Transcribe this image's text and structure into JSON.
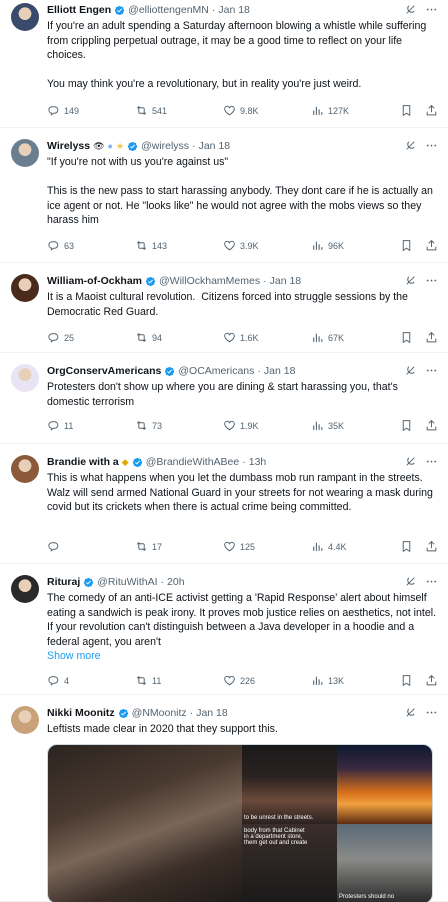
{
  "tweets": [
    {
      "name": "Elliott Engen",
      "badges": [],
      "handle": "@elliottengenMN",
      "time": "Jan 18",
      "text": "If you're an adult spending a Saturday afternoon blowing a whistle while suffering from crippling perpetual outrage, it may be a good time to reflect on your life choices.\n\nYou may think you're a revolutionary, but in reality you're just weird.",
      "replies": "149",
      "reposts": "541",
      "likes": "9.8K",
      "views": "127K",
      "avatar_color": "#3a4a6b"
    },
    {
      "name": "Wirelyss",
      "badges": [
        "eye-emoji",
        "speech-bubble-emoji",
        "sparkle-star-emoji"
      ],
      "handle": "@wirelyss",
      "time": "Jan 18",
      "text": "\"If you're not with us you're against us\"\n\nThis is the new pass to start harassing anybody. They dont care if he is actually an ice agent or not. He \"looks like\" he would not agree with the mobs views so they harass him",
      "replies": "63",
      "reposts": "143",
      "likes": "3.9K",
      "views": "96K",
      "avatar_color": "#6b7e8f"
    },
    {
      "name": "William-of-Ockham",
      "badges": [],
      "handle": "@WillOckhamMemes",
      "time": "Jan 18",
      "text": "It is a Maoist cultural revolution.  Citizens forced into struggle sessions by the Democratic Red Guard.",
      "replies": "25",
      "reposts": "94",
      "likes": "1.6K",
      "views": "67K",
      "avatar_color": "#4a2a1a"
    },
    {
      "name": "OrgConservAmericans",
      "badges": [],
      "handle": "@OCAmericans",
      "time": "Jan 18",
      "text": "Protesters don't show up where you are dining & start harassing you, that's domestic terrorism",
      "replies": "11",
      "reposts": "73",
      "likes": "1.9K",
      "views": "35K",
      "avatar_color": "#e8e4f4"
    },
    {
      "name": "Brandie with a",
      "badges": [
        "bee-emoji"
      ],
      "handle": "@BrandieWithABee",
      "time": "13h",
      "text": "This is what happens when you let the dumbass mob run rampant in the streets. Walz will send armed National Guard in your streets for not wearing a mask during covid but its crickets when there is actual crime being committed.",
      "replies": "",
      "reposts": "17",
      "likes": "125",
      "views": "4.4K",
      "avatar_color": "#8a5a3a"
    },
    {
      "name": "Rituraj",
      "badges": [],
      "handle": "@RituWithAI",
      "time": "20h",
      "text": "The comedy of an anti-ICE activist getting a 'Rapid Response' alert about himself eating a sandwich is peak irony. It proves mob justice relies on aesthetics, not intel. If your revolution can't distinguish between a Java developer in a hoodie and a federal agent, you aren't",
      "show_more": "Show more",
      "replies": "4",
      "reposts": "11",
      "likes": "226",
      "views": "13K",
      "avatar_color": "#2a2a2a"
    },
    {
      "name": "Nikki Moonitz",
      "badges": [],
      "handle": "@NMoonitz",
      "time": "Jan 18",
      "text": "Leftists made clear in 2020 that they support this.",
      "media_captions": [
        "to be unrest in the streets.",
        "Protesters should no",
        "body from that Cabinet\nin a department store,\nthem get out and create"
      ],
      "avatar_color": "#c9a27a"
    }
  ],
  "colors": {
    "accent": "#1d9bf0",
    "verified": "#1d9bf0",
    "muted": "#536471"
  },
  "icons": {
    "reply": "reply-icon",
    "repost": "repost-icon",
    "like": "heart-icon",
    "views": "views-icon",
    "bookmark": "bookmark-icon",
    "share": "share-icon",
    "grok": "grok-icon",
    "more": "more-icon"
  }
}
